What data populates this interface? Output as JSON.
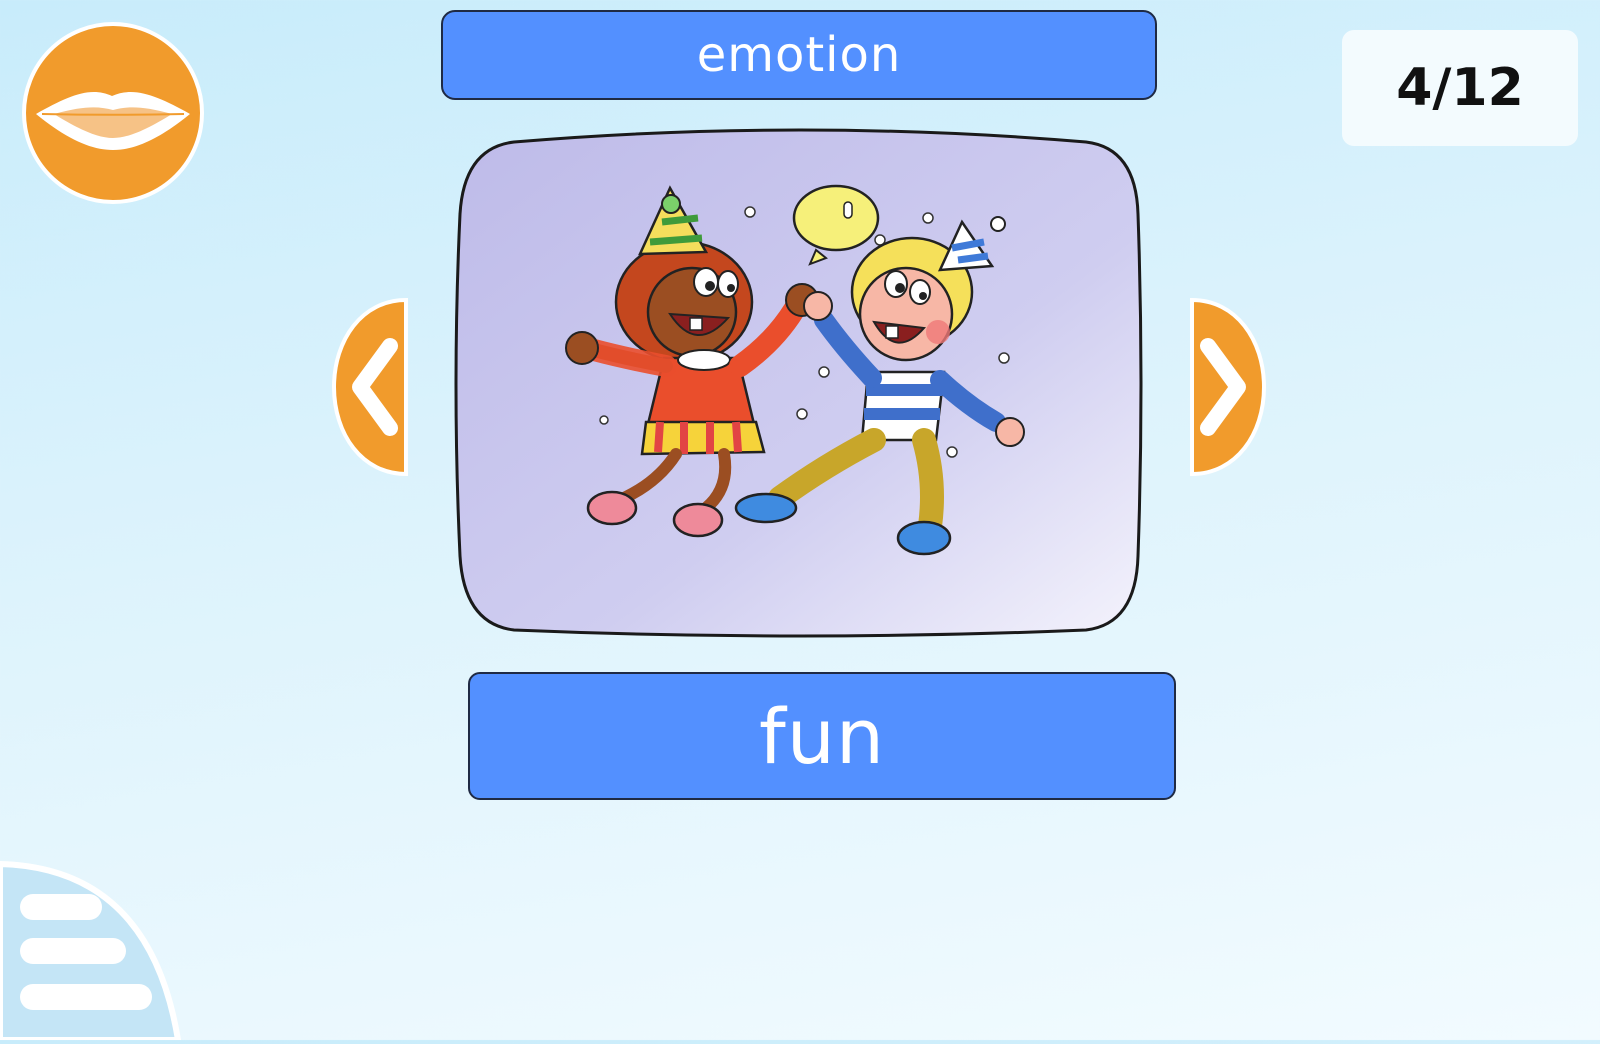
{
  "header": {
    "category": "emotion",
    "progress": "4/12"
  },
  "card": {
    "word": "fun",
    "image": "two children dancing at a party with party hats and a balloon"
  },
  "controls": {
    "speak_icon": "lips-icon",
    "prev_icon": "chevron-left-icon",
    "next_icon": "chevron-right-icon",
    "menu_icon": "hamburger-menu-icon"
  },
  "colors": {
    "accent_orange": "#f19b2c",
    "bar_blue": "#5390ff",
    "card_lavender": "#c8c6ee",
    "background": "#d6f0fb"
  }
}
